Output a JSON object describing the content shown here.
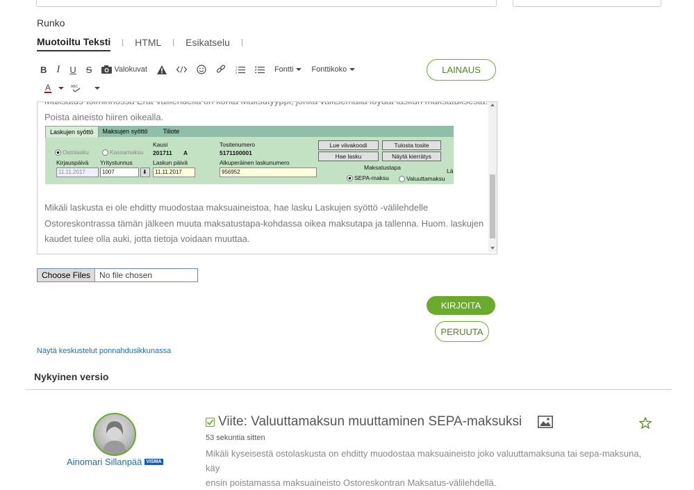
{
  "form": {
    "body_label": "Runko",
    "tabs": [
      {
        "label": "Muotoiltu Teksti",
        "active": true
      },
      {
        "label": "HTML",
        "active": false
      },
      {
        "label": "Esikatselu",
        "active": false
      }
    ],
    "tab_separator": "|",
    "toolbar": {
      "bold": "B",
      "italic": "I",
      "underline": "U",
      "strike": "S",
      "photos_label": "Valokuvat",
      "font_label": "Fontti",
      "font_size_label": "Fonttikoko",
      "quote_button": "LAINAUS",
      "text_color": "A"
    },
    "editor": {
      "partial_line": "Maksatus-toiminnossa Erät-välilehdellä on kohta Maksutyyppi, jonka valitsemalla löydät laskun maksatuksesta.",
      "line1": "Poista aineisto hiiren oikealla.",
      "para2_line1": "Mikäli laskusta ei ole ehditty muodostaa maksuaineistoa, hae lasku Laskujen syöttö -välilehdelle",
      "para2_line2": "Ostoreskontrassa tämän jälkeen muuta maksatustapa-kohdassa oikea maksutapa ja tallenna. Huom. laskujen",
      "para2_line3": "kaudet tulee olla auki, jotta tietoja voidaan muuttaa."
    },
    "embedded_screenshot": {
      "tabs": [
        "Laskujen syöttö",
        "Maksujen syöttö",
        "Tiliote"
      ],
      "radio_ostolasku": "Ostolasku",
      "radio_kassamaksu": "Kassamaksu",
      "kausi_label": "Kausi",
      "kausi_value": "201711",
      "kausi_suffix": "A",
      "tositenumero_label": "Tositenumero",
      "tositenumero_value": "5171100001",
      "btn_lue": "Lue viivakoodi",
      "btn_tulosta": "Tulosta tosite",
      "btn_hae": "Hae lasku",
      "btn_nayta": "Näytä kierrätys",
      "kirjauspaiva_label": "Kirjauspäivä",
      "kirjauspaiva_value": "11.11.2017",
      "yritystunnus_label": "Yritystunnus",
      "yritystunnus_value": "1007",
      "laskun_paiva_label": "Laskun päivä",
      "laskun_paiva_value": "11.11.2017",
      "alkuperainen_label": "Alkuperäinen laskunumero",
      "alkuperainen_value": "956952",
      "maksatustapa_label": "Maksatustapa",
      "sepa_label": "SEPA-maksu",
      "valuutta_label": "Valuuttamaksu",
      "cut_label": "Lä"
    },
    "file": {
      "button": "Choose Files",
      "status": "No file chosen"
    },
    "submit_button": "KIRJOITA",
    "cancel_button": "PERUUTA",
    "popup_link": "Näytä keskustelut ponnahdusikkunassa"
  },
  "current_version": {
    "heading": "Nykyinen versio",
    "author": "Ainomari Sillanpää",
    "author_badge": "VISMA",
    "title": "Viite: Valuuttamaksun muuttaminen SEPA-maksuksi",
    "time": "53 sekuntia sitten",
    "body_line1": "Mikäli kyseisestä ostolaskusta on ehditty muodostaa maksuaineisto joko valuuttamaksuna tai sepa-maksuna, käy",
    "body_line2": "ensin poistamassa maksuaineisto Ostoreskontran Maksatus-välilehdellä."
  },
  "colors": {
    "accent_green": "#6aab2e",
    "link_blue": "#1a6fbf"
  },
  "icons": [
    "camera-icon",
    "warning-icon",
    "code-icon",
    "smiley-icon",
    "link-icon",
    "ordered-list-icon",
    "bullet-list-icon",
    "spellcheck-icon",
    "check-icon",
    "image-icon",
    "star-icon"
  ]
}
